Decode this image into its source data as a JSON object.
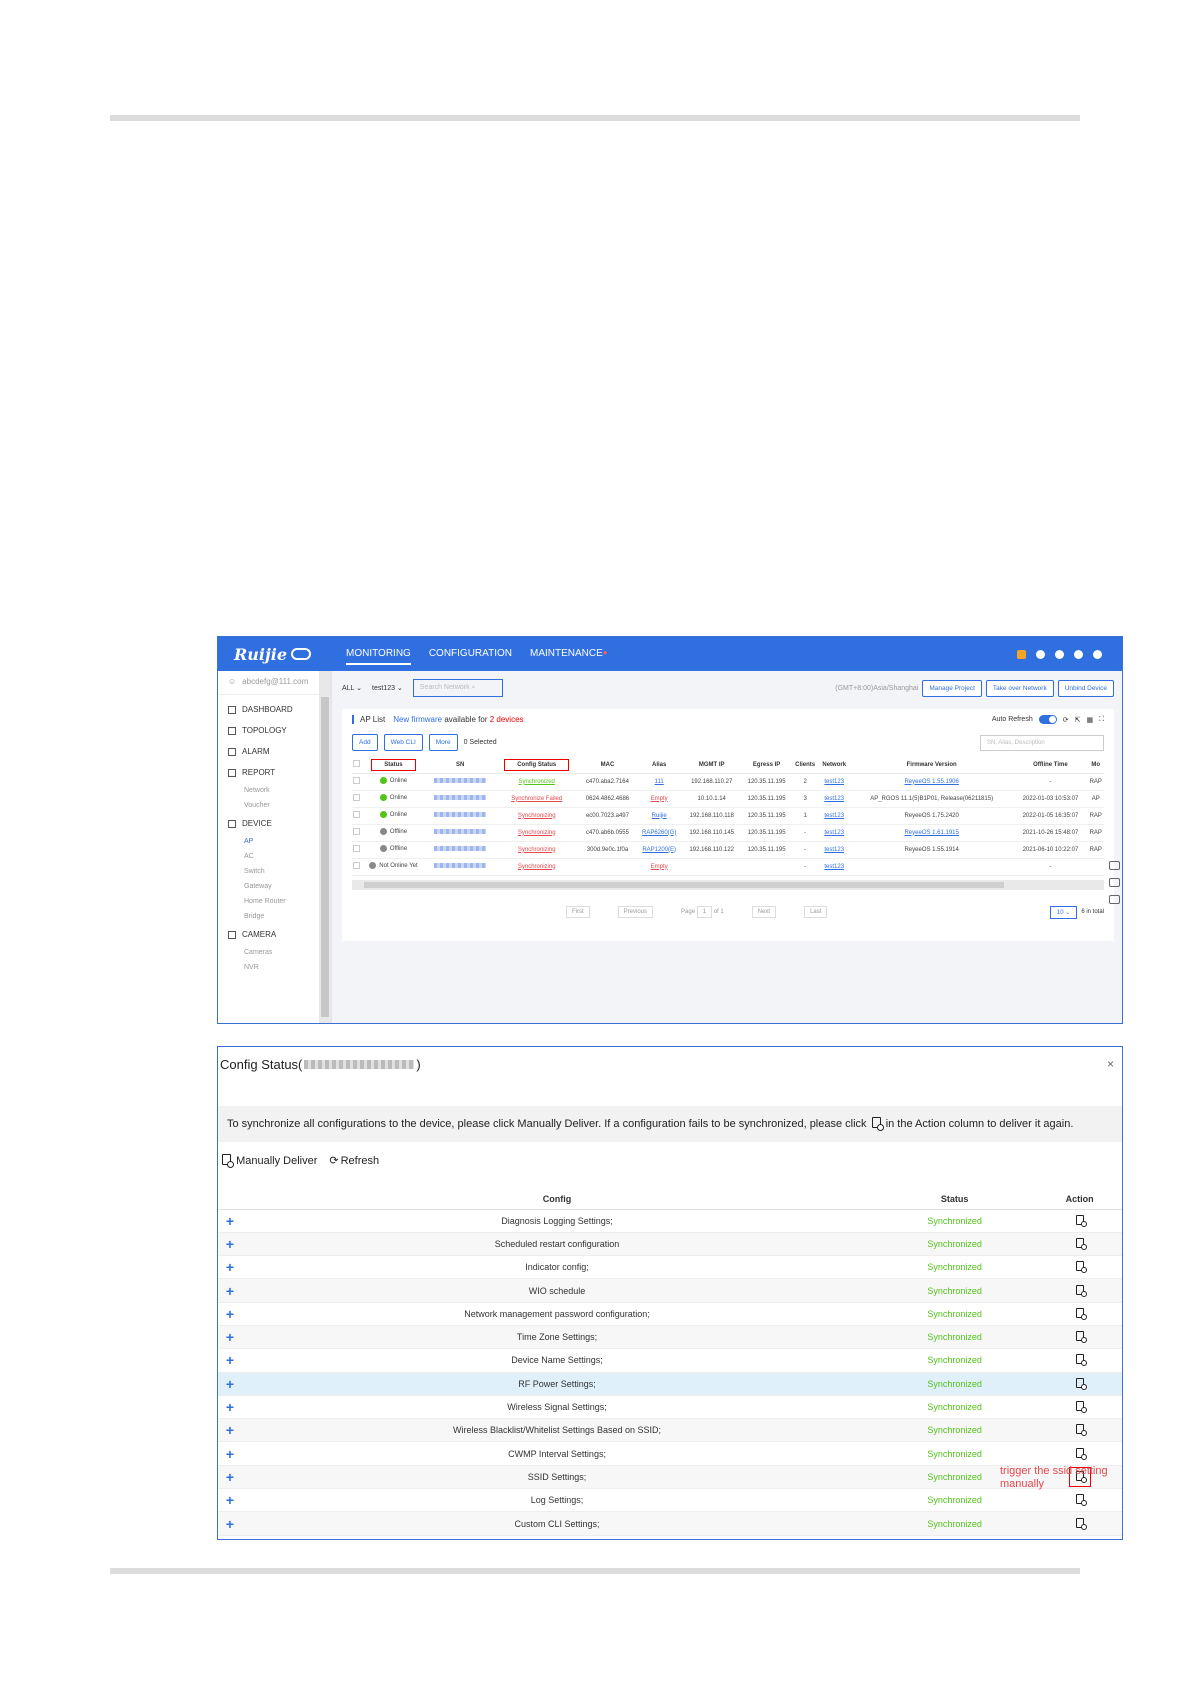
{
  "shot1": {
    "logo": "Ruijie",
    "nav": [
      "MONITORING",
      "CONFIGURATION",
      "MAINTENANCE"
    ],
    "nav_dot": "●",
    "user": "abcdefg@111.com",
    "sidebar": {
      "dashboard": "DASHBOARD",
      "topology": "TOPOLOGY",
      "alarm": "ALARM",
      "report": "REPORT",
      "report_items": [
        "Network",
        "Voucher"
      ],
      "device": "DEVICE",
      "device_items": [
        "AP",
        "AC",
        "Switch",
        "Gateway",
        "Home Router",
        "Bridge"
      ],
      "camera": "CAMERA",
      "camera_items": [
        "Cameras",
        "NVR"
      ]
    },
    "filter": {
      "scope": "ALL",
      "network": "test123",
      "search_placeholder": "Search Network",
      "timezone": "(GMT+8:00)Asia/Shanghai",
      "manage_project": "Manage Project",
      "take_over": "Take over Network",
      "unbind": "Unbind Device"
    },
    "card": {
      "title": "AP List",
      "firmware_link": "New firmware",
      "firmware_text": "available for",
      "firmware_count": "2 devices",
      "auto_refresh": "Auto Refresh",
      "add": "Add",
      "webcli": "Web CLI",
      "more": "More",
      "selected": "0 Selected",
      "search_placeholder": "SN, Alias, Description"
    },
    "columns": [
      "Status",
      "SN",
      "Config Status",
      "MAC",
      "Alias",
      "MGMT IP",
      "Egress IP",
      "Clients",
      "Network",
      "Firmware Version",
      "Offline Time",
      "Mo"
    ],
    "rows": [
      {
        "status": "Online",
        "dot": "green",
        "config": "Synchronized",
        "cfg_color": "green",
        "mac": "c470.aba2.7164",
        "alias": "111",
        "alias_color": "blue",
        "mgmt": "192.168.110.27",
        "egress": "120.35.11.195",
        "clients": "2",
        "network": "test123",
        "fw": "ReyeeOS 1.55.1906",
        "fw_link": true,
        "offline": "-",
        "model": "RAP"
      },
      {
        "status": "Online",
        "dot": "green",
        "config": "Synchronize Failed",
        "cfg_color": "red",
        "mac": "0624.4862.4686",
        "alias": "Empty",
        "alias_color": "red",
        "mgmt": "10.10.1.14",
        "egress": "120.35.11.195",
        "clients": "3",
        "network": "test123",
        "fw": "AP_RGOS 11.1(5)B1P01, Release(06211815)",
        "fw_link": false,
        "offline": "2022-01-03 10:53:07",
        "model": "AP"
      },
      {
        "status": "Online",
        "dot": "green",
        "config": "Synchronizing",
        "cfg_color": "red",
        "mac": "ec00.7023.a497",
        "alias": "Ruijie",
        "alias_color": "blue",
        "mgmt": "192.168.110.118",
        "egress": "120.35.11.195",
        "clients": "1",
        "network": "test123",
        "fw": "ReyeeOS 1.75.2420",
        "fw_link": false,
        "offline": "2022-01-05 16:35:07",
        "model": "RAP"
      },
      {
        "status": "Offline",
        "dot": "grey",
        "config": "Synchronizing",
        "cfg_color": "red",
        "mac": "c470.ab6b.0555",
        "alias": "RAP6260(G)",
        "alias_color": "blue",
        "mgmt": "192.168.110.145",
        "egress": "120.35.11.195",
        "clients": "-",
        "network": "test123",
        "fw": "ReyeeOS 1.61.1915",
        "fw_link": true,
        "offline": "2021-10-26 15:48:07",
        "model": "RAP"
      },
      {
        "status": "Offline",
        "dot": "grey",
        "config": "Synchronizing",
        "cfg_color": "red",
        "mac": "300d.9e0c.1f0a",
        "alias": "RAP1200(E)",
        "alias_color": "blue",
        "mgmt": "192.168.110.122",
        "egress": "120.35.11.195",
        "clients": "-",
        "network": "test123",
        "fw": "ReyeeOS 1.55.1914",
        "fw_link": false,
        "offline": "2021-06-10 10:22:07",
        "model": "RAP"
      },
      {
        "status": "Not Online Yet",
        "dot": "grey",
        "config": "Synchronizing",
        "cfg_color": "red",
        "mac": "",
        "alias": "Empty",
        "alias_color": "red",
        "mgmt": "",
        "egress": "",
        "clients": "-",
        "network": "test123",
        "fw": "",
        "fw_link": false,
        "offline": "-",
        "model": ""
      }
    ],
    "pager": {
      "first": "First",
      "previous": "Previous",
      "page": "Page",
      "current": "1",
      "of": "of 1",
      "next": "Next",
      "last": "Last",
      "per_page": "10",
      "total": "6 in total"
    }
  },
  "shot2": {
    "title_prefix": "Config Status(",
    "title_suffix": ")",
    "close": "×",
    "notice_a": "To synchronize all configurations to the device, please click Manually Deliver. If a configuration fails to be synchronized, please click",
    "notice_b": "in the Action column to deliver it again.",
    "manual": "Manually Deliver",
    "refresh": "Refresh",
    "columns": [
      "Config",
      "Status",
      "Action"
    ],
    "rows": [
      {
        "config": "Diagnosis Logging Settings;",
        "status": "Synchronized"
      },
      {
        "config": "Scheduled restart configuration",
        "status": "Synchronized"
      },
      {
        "config": "Indicator config;",
        "status": "Synchronized"
      },
      {
        "config": "WIO schedule",
        "status": "Synchronized"
      },
      {
        "config": "Network management password configuration;",
        "status": "Synchronized"
      },
      {
        "config": "Time Zone Settings;",
        "status": "Synchronized"
      },
      {
        "config": "Device Name Settings;",
        "status": "Synchronized"
      },
      {
        "config": "RF Power Settings;",
        "status": "Synchronized"
      },
      {
        "config": "Wireless Signal Settings;",
        "status": "Synchronized"
      },
      {
        "config": "Wireless Blacklist/Whitelist Settings Based on SSID;",
        "status": "Synchronized"
      },
      {
        "config": "CWMP Interval Settings;",
        "status": "Synchronized"
      },
      {
        "config": "SSID Settings;",
        "status": "Synchronized"
      },
      {
        "config": "Log Settings;",
        "status": "Synchronized"
      },
      {
        "config": "Custom CLI Settings;",
        "status": "Synchronized"
      }
    ],
    "annotation": "trigger the ssid setting manually"
  }
}
